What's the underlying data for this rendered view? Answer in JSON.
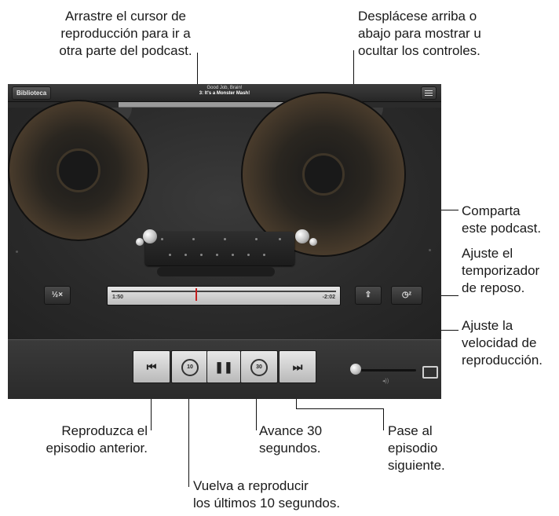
{
  "nav": {
    "library_button": "Biblioteca",
    "podcast_title": "Good Job, Brain!",
    "episode_title": "3: It's a Monster Mash!"
  },
  "player": {
    "speed_label": "½×",
    "elapsed_time": "1:50",
    "remaining_time": "-2:02",
    "progress_fraction": 0.47,
    "share_icon": "share-icon",
    "sleep_timer_icon": "sleep-timer-icon",
    "airplay_icon": "airplay-icon",
    "volume_icon": "volume-icon",
    "skip_back_seconds": "10",
    "skip_forward_seconds": "30"
  },
  "callouts": {
    "scrubber_line1": "Arrastre el cursor de",
    "scrubber_line2": "reproducción para ir a",
    "scrubber_line3": "otra parte del podcast.",
    "controls_line1": "Desplácese arriba o",
    "controls_line2": "abajo para mostrar u",
    "controls_line3": "ocultar los controles.",
    "share_line1": "Comparta",
    "share_line2": "este podcast.",
    "sleep_line1": "Ajuste el",
    "sleep_line2": "temporizador",
    "sleep_line3": "de reposo.",
    "speed_line1": "Ajuste la",
    "speed_line2": "velocidad de",
    "speed_line3": "reproducción.",
    "prev_line1": "Reproduzca el",
    "prev_line2": "episodio anterior.",
    "back10_line1": "Vuelva a reproducir",
    "back10_line2": "los últimos 10 segundos.",
    "fwd30_line1": "Avance 30",
    "fwd30_line2": "segundos.",
    "next_line1": "Pase al",
    "next_line2": "episodio",
    "next_line3": "siguiente."
  }
}
